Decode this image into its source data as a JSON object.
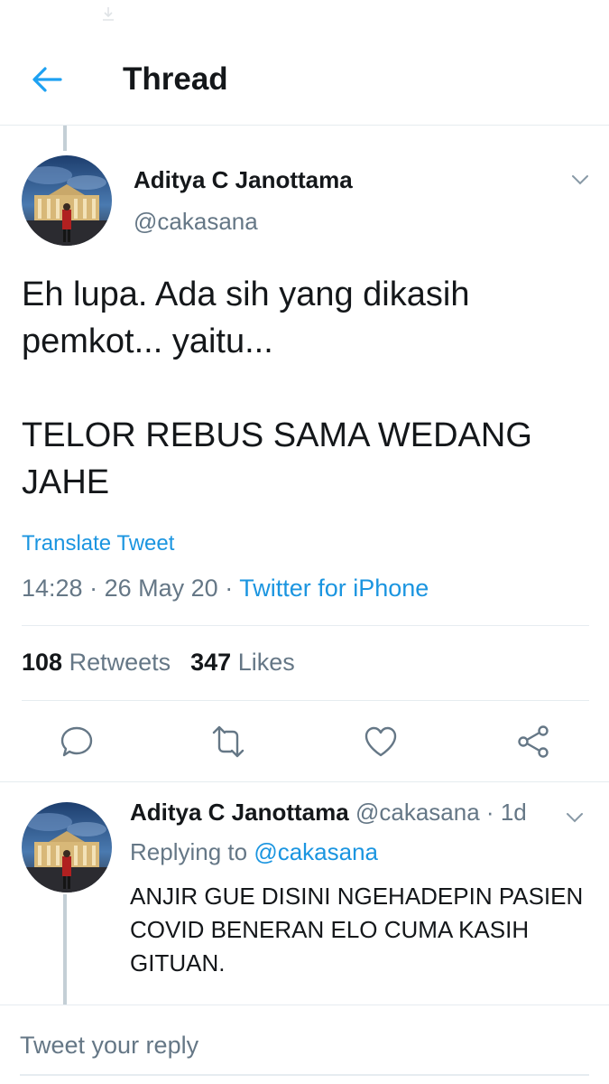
{
  "header": {
    "title": "Thread"
  },
  "main_tweet": {
    "author_name": "Aditya C Janottama",
    "author_handle": "@cakasana",
    "text_line1": "Eh lupa. Ada sih yang dikasih",
    "text_line2": "pemkot... yaitu...",
    "text_line3": "TELOR REBUS SAMA WEDANG",
    "text_line4": "JAHE",
    "translate_label": "Translate Tweet",
    "time": "14:28",
    "separator": "·",
    "date": "26 May 20",
    "source": "Twitter for iPhone",
    "retweet_count": "108",
    "retweet_label": "Retweets",
    "like_count": "347",
    "like_label": "Likes"
  },
  "reply": {
    "author_name": "Aditya C Janottama",
    "author_handle": "@cakasana",
    "separator": "·",
    "age": "1d",
    "replying_prefix": "Replying to",
    "replying_to": "@cakasana",
    "text_line1": "ANJIR GUE DISINI NGEHADEPIN PASIEN",
    "text_line2": "COVID BENERAN ELO CUMA KASIH",
    "text_line3": "GITUAN."
  },
  "composer": {
    "placeholder": "Tweet your reply"
  },
  "icons": {
    "back": "arrow-left-icon",
    "caret": "chevron-down-icon",
    "reply": "speech-bubble-icon",
    "retweet": "retweet-icon",
    "like": "heart-icon",
    "share": "share-icon"
  },
  "colors": {
    "accent": "#1da1f2",
    "link": "#1b95e0",
    "secondary_text": "#657786",
    "divider": "#e6ecf0"
  }
}
